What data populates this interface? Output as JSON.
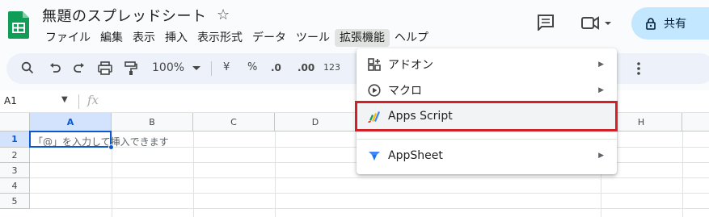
{
  "header": {
    "title": "無題のスプレッドシート",
    "menu": [
      "ファイル",
      "編集",
      "表示",
      "挿入",
      "表示形式",
      "データ",
      "ツール",
      "拡張機能",
      "ヘルプ"
    ],
    "active_menu_index": 7,
    "share_label": "共有"
  },
  "toolbar": {
    "zoom": "100%",
    "currency": "¥",
    "percent": "%",
    "decimal_decrease": ".0",
    "decimal_increase": ".00",
    "number_format": "123"
  },
  "formula_bar": {
    "cell_ref": "A1",
    "fx_label": "fx"
  },
  "grid": {
    "columns": [
      "A",
      "B",
      "C",
      "D",
      "H"
    ],
    "rows": [
      "1",
      "2",
      "3",
      "4",
      "5"
    ],
    "active_cell_hint": "「@」を入力して挿入できます"
  },
  "extensions_menu": {
    "items": [
      {
        "label": "アドオン",
        "icon": "addon-icon",
        "has_submenu": true
      },
      {
        "label": "マクロ",
        "icon": "macro-icon",
        "has_submenu": true
      },
      {
        "label": "Apps Script",
        "icon": "apps-script-icon",
        "has_submenu": false
      },
      {
        "label": "AppSheet",
        "icon": "appsheet-icon",
        "has_submenu": true
      }
    ]
  },
  "colors": {
    "accent": "#0b57d0",
    "share_bg": "#c2e7ff",
    "highlight_border": "#d32027",
    "sheets_green": "#0f9d58"
  }
}
